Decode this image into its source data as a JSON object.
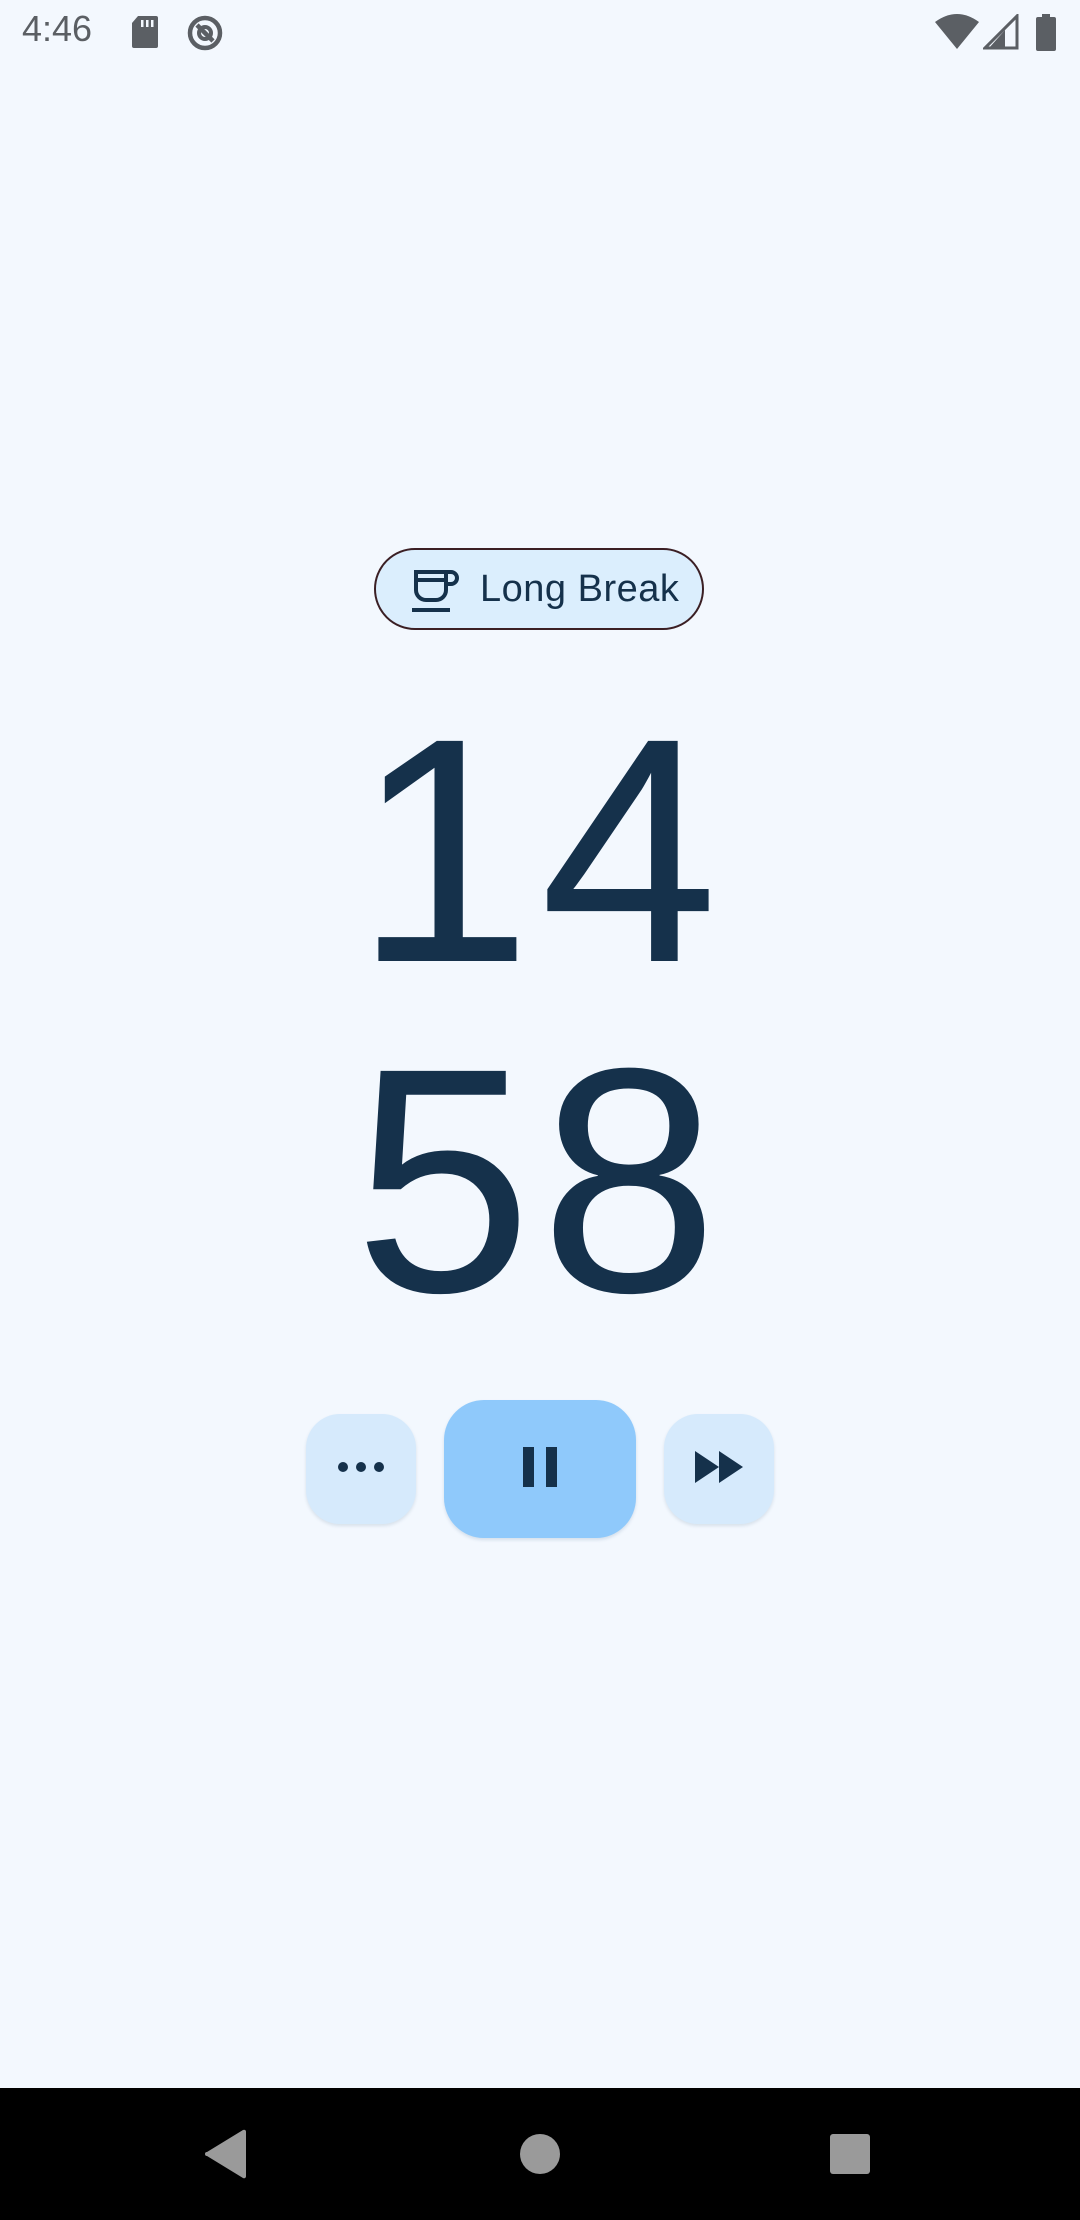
{
  "status_bar": {
    "time": "4:46",
    "icons": [
      "sd-card-icon",
      "assistant-icon",
      "wifi-icon",
      "signal-icon",
      "battery-icon"
    ]
  },
  "timer": {
    "mode_label": "Long Break",
    "mode_icon": "coffee-cup-icon",
    "minutes": "14",
    "seconds": "58"
  },
  "controls": {
    "more_icon": "more-horizontal-icon",
    "pause_icon": "pause-icon",
    "skip_icon": "fast-forward-icon"
  },
  "navigation": {
    "icons": [
      "back-icon",
      "home-icon",
      "recents-icon"
    ]
  },
  "colors": {
    "background": "#f3f8fe",
    "text": "#15314b",
    "chip_bg": "#dbeefd",
    "primary_button": "#8fc9fb",
    "secondary_button": "#d6eafc"
  }
}
